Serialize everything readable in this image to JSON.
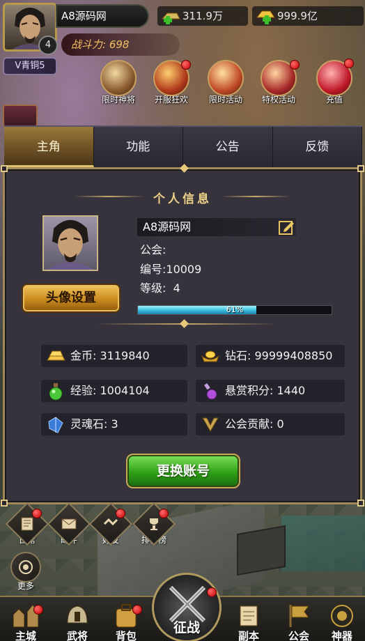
{
  "hud": {
    "player_name": "A8源码网",
    "level": "4",
    "silver": "311.9万",
    "gold": "999.9亿",
    "power": "战斗力: 698",
    "vip": "V青铜5"
  },
  "top_icons": [
    {
      "label": "限时神将"
    },
    {
      "label": "开服狂欢"
    },
    {
      "label": "限时活动"
    },
    {
      "label": "特权活动"
    },
    {
      "label": "充值"
    }
  ],
  "tabs": [
    {
      "label": "主角"
    },
    {
      "label": "功能"
    },
    {
      "label": "公告"
    },
    {
      "label": "反馈"
    }
  ],
  "panel": {
    "title": "个人信息",
    "avatar_button": "头像设置",
    "name": "A8源码网",
    "guild": "公会:",
    "id_line": "编号:10009",
    "level_line": "等级:  4",
    "xp_label": "61%",
    "xp_fraction": 0.61,
    "stats": {
      "gold": "金币: 3119840",
      "diamond": "钻石: 99999408850",
      "exp": "经验: 1004104",
      "bounty": "悬赏积分: 1440",
      "soulstone": "灵魂石: 3",
      "contribution": "公会贡献: 0"
    },
    "switch_button": "更换账号"
  },
  "side_nav": [
    {
      "label": "日常"
    },
    {
      "label": "邮件"
    },
    {
      "label": "好友"
    },
    {
      "label": "排行榜"
    },
    {
      "label": "更多"
    }
  ],
  "bottom_nav": [
    {
      "label": "主城"
    },
    {
      "label": "武将"
    },
    {
      "label": "背包"
    },
    {
      "label": "征战"
    },
    {
      "label": "副本"
    },
    {
      "label": "公会"
    },
    {
      "label": "神器"
    }
  ],
  "colors": {
    "gold_accent": "#efd28a",
    "panel_bg": "#36333d",
    "xp_fill": "#3cc0e0",
    "switch_green": "#2fa018"
  }
}
